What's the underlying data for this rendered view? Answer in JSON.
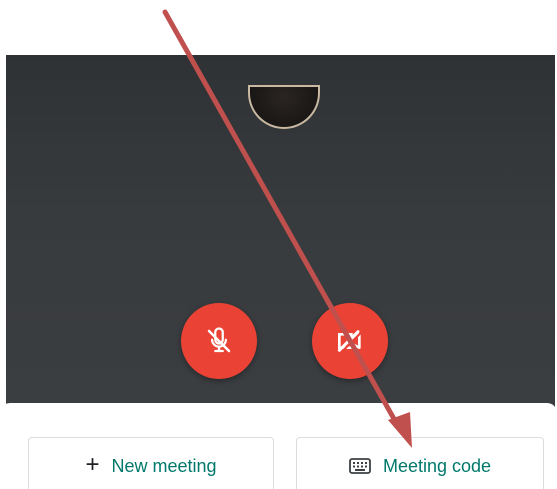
{
  "preview": {
    "mic_icon": "mic-off-icon",
    "camera_icon": "videocam-off-icon",
    "accent_color": "#ea4335"
  },
  "actions": {
    "new_meeting_icon": "plus-icon",
    "new_meeting_label": "New meeting",
    "meeting_code_icon": "keyboard-icon",
    "meeting_code_label": "Meeting code",
    "label_color": "#00796b"
  },
  "annotation": {
    "type": "arrow",
    "color": "#c0504d",
    "points_to": "meeting-code-button"
  }
}
